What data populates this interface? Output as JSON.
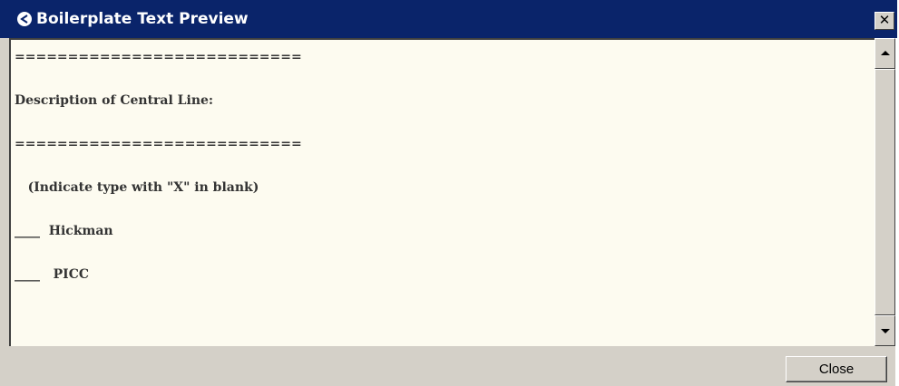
{
  "window": {
    "title": "Boilerplate Text Preview",
    "close_glyph": "✕",
    "title_icon": "app-logo-icon"
  },
  "content": {
    "lines": [
      "===========================",
      "Description of Central Line:",
      "===========================",
      "   (Indicate type with \"X\" in blank)",
      "____  Hickman",
      "____   PICC"
    ]
  },
  "scrollbar": {
    "up_icon": "scroll-up-arrow-icon",
    "down_icon": "scroll-down-arrow-icon"
  },
  "footer": {
    "close_label": "Close"
  }
}
